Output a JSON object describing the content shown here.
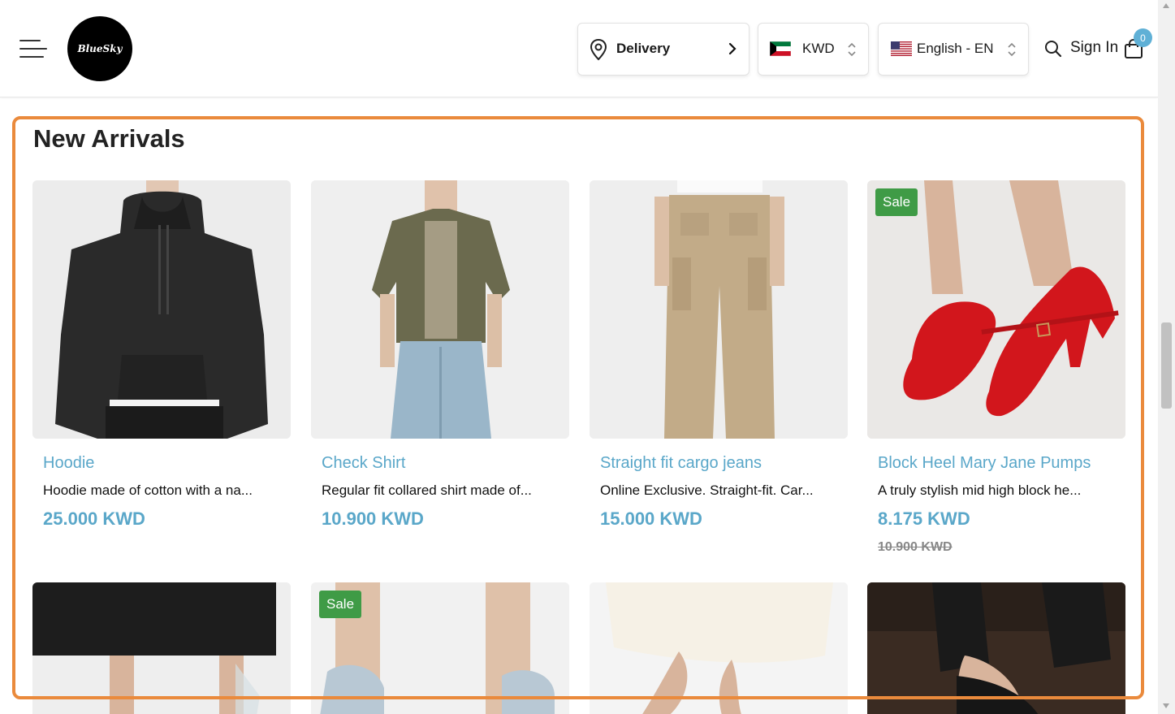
{
  "header": {
    "logo_text": "BlueSky",
    "delivery_label": "Delivery",
    "currency_label": "KWD",
    "language_label": "English - EN",
    "signin_label": "Sign In",
    "cart_count": "0"
  },
  "section": {
    "title": "New Arrivals"
  },
  "products": [
    {
      "name": "Hoodie",
      "description": "Hoodie made of cotton with a na...",
      "price": "25.000 KWD"
    },
    {
      "name": "Check Shirt",
      "description": "Regular fit collared shirt made of...",
      "price": "10.900 KWD"
    },
    {
      "name": "Straight fit cargo jeans",
      "description": "Online Exclusive. Straight-fit. Car...",
      "price": "15.000 KWD"
    },
    {
      "name": "Block Heel Mary Jane Pumps",
      "description": "A truly stylish mid high block he...",
      "price": "8.175 KWD",
      "old_price": "10.900 KWD",
      "badge": "Sale"
    }
  ],
  "second_row": [
    {
      "badge": ""
    },
    {
      "badge": "Sale"
    },
    {
      "badge": ""
    },
    {
      "badge": ""
    }
  ],
  "colors": {
    "accent": "#5aa7c9",
    "sale_badge": "#3f9b46",
    "highlight": "#ea8a3c",
    "cart_badge": "#5fb0d6"
  }
}
